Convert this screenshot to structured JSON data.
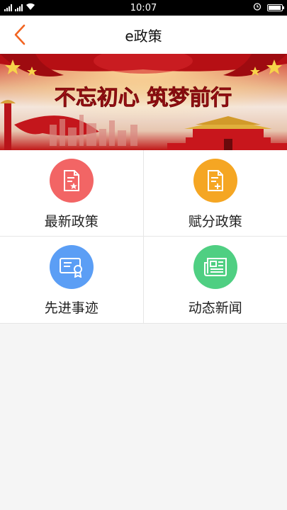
{
  "status_bar": {
    "left": "4G 4G",
    "time": "10:07"
  },
  "nav": {
    "title": "e政策",
    "back_icon": "chevron-left-icon"
  },
  "banner": {
    "slogan": "不忘初心 筑梦前行"
  },
  "menu": [
    {
      "label": "最新政策",
      "icon": "document-star-icon",
      "color": "#f26565"
    },
    {
      "label": "赋分政策",
      "icon": "document-plus-icon",
      "color": "#f5a623"
    },
    {
      "label": "先进事迹",
      "icon": "certificate-icon",
      "color": "#5b9ef5"
    },
    {
      "label": "动态新闻",
      "icon": "newspaper-icon",
      "color": "#4fcf82"
    }
  ],
  "colors": {
    "accent": "#f26522"
  }
}
